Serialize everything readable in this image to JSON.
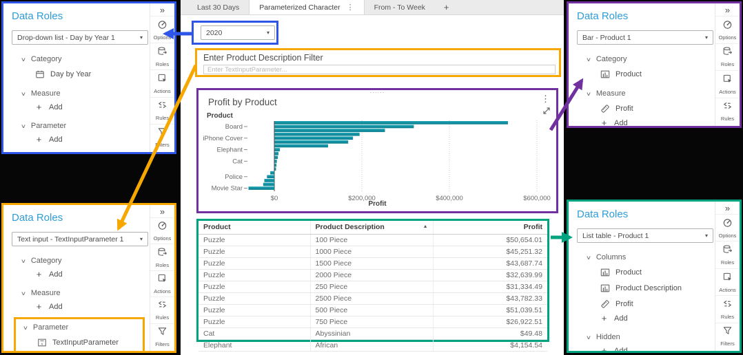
{
  "colors": {
    "blue": "#2e54e8",
    "orange": "#f6a800",
    "purple": "#7030a0",
    "teal": "#00a380",
    "title_blue": "#2f9dd8",
    "bar_fill": "#0e8a9c"
  },
  "icons": {
    "collapse": "»",
    "caret": "▾",
    "section_chevron": "∨",
    "plus": "+",
    "kebab": "⋮",
    "sort_asc": "▲",
    "drag_handle": "······"
  },
  "canvas": {
    "tabs": [
      {
        "label": "Last 30 Days",
        "active": false
      },
      {
        "label": "Parameterized Character",
        "active": true
      },
      {
        "label": "From - To Week",
        "active": false
      }
    ],
    "new_tab_label": "+",
    "year_dropdown": {
      "value": "2020"
    },
    "filter": {
      "label": "Enter Product Description Filter",
      "placeholder": "Enter TextInputParameter..."
    }
  },
  "panels": {
    "dropdown": {
      "title": "Data Roles",
      "selector_value": "Drop-down list - Day by Year 1",
      "rail": [
        "Options",
        "Roles",
        "Actions",
        "Rules",
        "Filters"
      ],
      "sections": [
        {
          "name": "Category",
          "items": [
            {
              "icon": "calendar-icon",
              "label": "Day by Year"
            }
          ]
        },
        {
          "name": "Measure",
          "items": [
            {
              "icon": "plus-icon",
              "label": "Add",
              "add": true
            }
          ]
        },
        {
          "name": "Parameter",
          "items": [
            {
              "icon": "plus-icon",
              "label": "Add",
              "add": true
            }
          ]
        }
      ]
    },
    "textinput": {
      "title": "Data Roles",
      "selector_value": "Text input - TextInputParameter 1",
      "rail": [
        "Options",
        "Roles",
        "Actions",
        "Rules",
        "Filters"
      ],
      "sections": [
        {
          "name": "Category",
          "items": [
            {
              "icon": "plus-icon",
              "label": "Add",
              "add": true
            }
          ]
        },
        {
          "name": "Measure",
          "items": [
            {
              "icon": "plus-icon",
              "label": "Add",
              "add": true
            }
          ]
        },
        {
          "name": "Parameter",
          "highlighted": true,
          "items": [
            {
              "icon": "parameter-icon",
              "label": "TextInputParameter"
            }
          ]
        }
      ]
    },
    "bar": {
      "title": "Data Roles",
      "selector_value": "Bar - Product 1",
      "rail": [
        "Options",
        "Roles",
        "Actions",
        "Rules"
      ],
      "sections": [
        {
          "name": "Category",
          "items": [
            {
              "icon": "columns-icon",
              "label": "Product"
            }
          ]
        },
        {
          "name": "Measure",
          "items": [
            {
              "icon": "ruler-icon",
              "label": "Profit"
            },
            {
              "icon": "plus-icon",
              "label": "Add",
              "add": true
            }
          ]
        }
      ]
    },
    "listtable": {
      "title": "Data Roles",
      "selector_value": "List table - Product 1",
      "rail": [
        "Options",
        "Roles",
        "Actions",
        "Rules",
        "Filters"
      ],
      "sections": [
        {
          "name": "Columns",
          "items": [
            {
              "icon": "columns-icon",
              "label": "Product"
            },
            {
              "icon": "columns-icon",
              "label": "Product Description"
            },
            {
              "icon": "ruler-icon",
              "label": "Profit"
            },
            {
              "icon": "plus-icon",
              "label": "Add",
              "add": true
            }
          ]
        },
        {
          "name": "Hidden",
          "items": [
            {
              "icon": "plus-icon",
              "label": "Add",
              "add": true
            }
          ]
        }
      ]
    }
  },
  "chart_data": {
    "type": "bar",
    "orientation": "horizontal",
    "title": "Profit by Product",
    "ylabel": "Product",
    "xlabel": "Profit",
    "x_ticks": [
      "$0",
      "$200,000",
      "$400,000",
      "$600,000"
    ],
    "x_tick_values": [
      0,
      200000,
      400000,
      600000
    ],
    "xlim": [
      -75000,
      620000
    ],
    "grid": "dotted-vertical",
    "bar_color": "#0e8a9c",
    "note": "18 bars sorted descending, only every third y tick labeled; values estimated from axis",
    "values": [
      533000,
      318000,
      252000,
      194000,
      179000,
      168000,
      122000,
      12000,
      8700,
      7200,
      5000,
      4100,
      3100,
      -9200,
      -16800,
      -22900,
      -25500,
      -59000
    ],
    "y_tick_labels": [
      {
        "label": "Board",
        "bar_index": 2
      },
      {
        "label": "iPhone Cover",
        "bar_index": 5
      },
      {
        "label": "Elephant",
        "bar_index": 8
      },
      {
        "label": "Cat",
        "bar_index": 11
      },
      {
        "label": "Police",
        "bar_index": 15
      },
      {
        "label": "Movie Star",
        "bar_index": 18
      }
    ]
  },
  "table": {
    "columns": [
      "Product",
      "Product Description",
      "Profit"
    ],
    "sort_column": "Product Description",
    "sort_direction": "ascending",
    "rows": [
      [
        "Puzzle",
        "100 Piece",
        "$50,654.01"
      ],
      [
        "Puzzle",
        "1000 Piece",
        "$45,251.32"
      ],
      [
        "Puzzle",
        "1500 Piece",
        "$43,687.74"
      ],
      [
        "Puzzle",
        "2000 Piece",
        "$32,639.99"
      ],
      [
        "Puzzle",
        "250 Piece",
        "$31,334.49"
      ],
      [
        "Puzzle",
        "2500 Piece",
        "$43,782.33"
      ],
      [
        "Puzzle",
        "500 Piece",
        "$51,039.51"
      ],
      [
        "Puzzle",
        "750 Piece",
        "$26,922.51"
      ],
      [
        "Cat",
        "Abyssinian",
        "$49.48"
      ],
      [
        "Elephant",
        "African",
        "$4,154.54"
      ]
    ]
  }
}
